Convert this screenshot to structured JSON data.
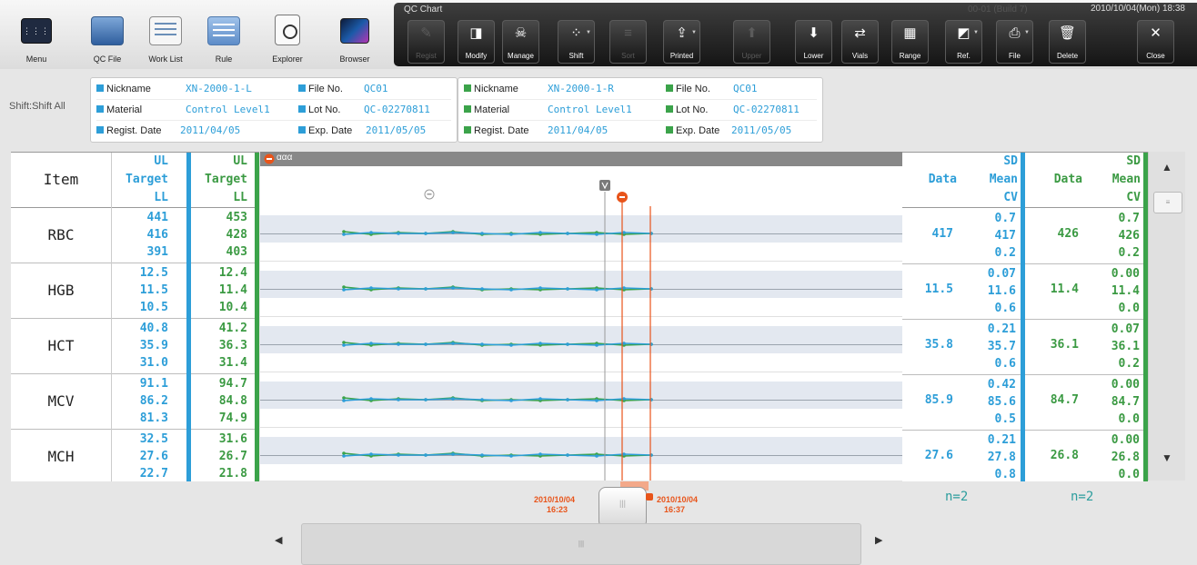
{
  "toolbar": {
    "left_buttons": [
      {
        "label": "Menu",
        "icon": "menu-icon"
      },
      {
        "label": "QC File",
        "icon": "qc-file-icon"
      },
      {
        "label": "Work List",
        "icon": "work-list-icon"
      },
      {
        "label": "Rule",
        "icon": "rule-icon"
      },
      {
        "label": "Explorer",
        "icon": "explorer-icon"
      },
      {
        "label": "Browser",
        "icon": "browser-icon"
      }
    ],
    "title": "QC Chart",
    "build": "00-01 (Build 7)",
    "datetime": "2010/10/04(Mon) 18:38",
    "buttons": [
      {
        "label": "Regist",
        "icon": "regist-icon",
        "glyph": "✎",
        "enabled": false
      },
      {
        "label": "Modify",
        "icon": "modify-icon",
        "glyph": "◨",
        "enabled": true
      },
      {
        "label": "Manage",
        "icon": "manage-icon",
        "glyph": "☠",
        "enabled": true
      },
      {
        "label": "Shift",
        "icon": "shift-icon",
        "glyph": "⁘",
        "enabled": true,
        "dropdown": true
      },
      {
        "label": "Sort",
        "icon": "sort-icon",
        "glyph": "≡",
        "enabled": false
      },
      {
        "label": "Printed",
        "icon": "printed-icon",
        "glyph": "⇪",
        "enabled": true,
        "dropdown": true
      },
      {
        "label": "Upper",
        "icon": "upper-icon",
        "glyph": "⬆",
        "enabled": false
      },
      {
        "label": "Lower",
        "icon": "lower-icon",
        "glyph": "⬇",
        "enabled": true
      },
      {
        "label": "Vials",
        "icon": "vials-icon",
        "glyph": "⇄",
        "enabled": true
      },
      {
        "label": "Range",
        "icon": "range-icon",
        "glyph": "▦",
        "enabled": true
      },
      {
        "label": "Ref.",
        "icon": "ref-icon",
        "glyph": "◩",
        "enabled": true,
        "dropdown": true
      },
      {
        "label": "File",
        "icon": "file-icon",
        "glyph": "⎙",
        "enabled": true,
        "dropdown": true
      },
      {
        "label": "Delete",
        "icon": "delete-icon",
        "glyph": "🗑",
        "enabled": true
      },
      {
        "label": "Close",
        "icon": "close-icon",
        "glyph": "✕",
        "enabled": true
      }
    ]
  },
  "shift_label": "Shift:Shift All",
  "file_l": {
    "nickname_key": "Nickname",
    "nickname": "XN-2000-1-L",
    "file_key": "File No.",
    "file_no": "QC01",
    "material_key": "Material",
    "material": "Control Level1",
    "lot_key": "Lot No.",
    "lot_no": "QC-02270811",
    "regist_key": "Regist. Date",
    "regist_date": "2011/04/05",
    "exp_key": "Exp. Date",
    "exp_date": "2011/05/05"
  },
  "file_r": {
    "nickname_key": "Nickname",
    "nickname": "XN-2000-1-R",
    "file_key": "File No.",
    "file_no": "QC01",
    "material_key": "Material",
    "material": "Control Level1",
    "lot_key": "Lot No.",
    "lot_no": "QC-02270811",
    "regist_key": "Regist. Date",
    "regist_date": "2011/04/05",
    "exp_key": "Exp. Date",
    "exp_date": "2011/05/05"
  },
  "table_header": {
    "item": "Item",
    "ul": "UL",
    "target": "Target",
    "ll": "LL",
    "data": "Data",
    "sd": "SD",
    "mean": "Mean",
    "cv": "CV"
  },
  "chart_tab": "ααα",
  "rows": [
    {
      "name": "RBC",
      "l": {
        "ul": "441",
        "target": "416",
        "ll": "391",
        "data": "417",
        "sd": "0.7",
        "mean": "417",
        "cv": "0.2"
      },
      "r": {
        "ul": "453",
        "target": "428",
        "ll": "403",
        "data": "426",
        "sd": "0.7",
        "mean": "426",
        "cv": "0.2"
      }
    },
    {
      "name": "HGB",
      "l": {
        "ul": "12.5",
        "target": "11.5",
        "ll": "10.5",
        "data": "11.5",
        "sd": "0.07",
        "mean": "11.6",
        "cv": "0.6"
      },
      "r": {
        "ul": "12.4",
        "target": "11.4",
        "ll": "10.4",
        "data": "11.4",
        "sd": "0.00",
        "mean": "11.4",
        "cv": "0.0"
      }
    },
    {
      "name": "HCT",
      "l": {
        "ul": "40.8",
        "target": "35.9",
        "ll": "31.0",
        "data": "35.8",
        "sd": "0.21",
        "mean": "35.7",
        "cv": "0.6"
      },
      "r": {
        "ul": "41.2",
        "target": "36.3",
        "ll": "31.4",
        "data": "36.1",
        "sd": "0.07",
        "mean": "36.1",
        "cv": "0.2"
      }
    },
    {
      "name": "MCV",
      "l": {
        "ul": "91.1",
        "target": "86.2",
        "ll": "81.3",
        "data": "85.9",
        "sd": "0.42",
        "mean": "85.6",
        "cv": "0.5"
      },
      "r": {
        "ul": "94.7",
        "target": "84.8",
        "ll": "74.9",
        "data": "84.7",
        "sd": "0.00",
        "mean": "84.7",
        "cv": "0.0"
      }
    },
    {
      "name": "MCH",
      "l": {
        "ul": "32.5",
        "target": "27.6",
        "ll": "22.7",
        "data": "27.6",
        "sd": "0.21",
        "mean": "27.8",
        "cv": "0.8"
      },
      "r": {
        "ul": "31.6",
        "target": "26.7",
        "ll": "21.8",
        "data": "26.8",
        "sd": "0.00",
        "mean": "26.8",
        "cv": "0.0"
      }
    }
  ],
  "cursor_left": {
    "date": "2010/10/04",
    "time": "16:23"
  },
  "cursor_right": {
    "date": "2010/10/04",
    "time": "16:37"
  },
  "n_l": "n=2",
  "n_r": "n=2",
  "colors": {
    "blue": "#2d9ed8",
    "green": "#3ba34a",
    "orange": "#e8541a",
    "band": "#e3e8f0"
  }
}
